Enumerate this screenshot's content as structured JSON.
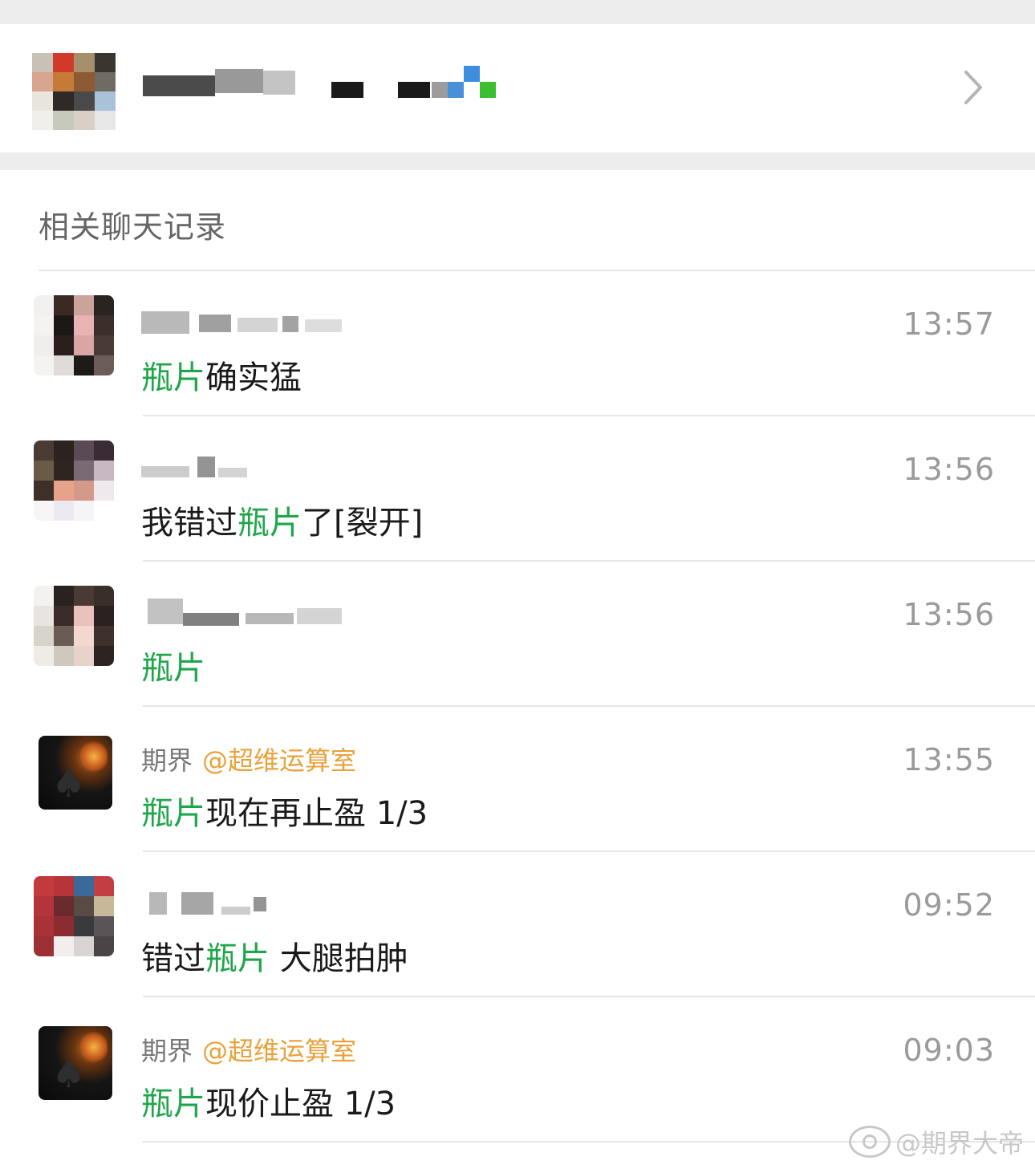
{
  "section_title": "相关聊天记录",
  "results": [
    {
      "sender": "",
      "mention": "",
      "highlight": "瓶片",
      "message_rest": "确实猛",
      "message_prefix": "",
      "time": "13:57"
    },
    {
      "sender": "",
      "mention": "",
      "message_prefix": "我错过",
      "highlight": "瓶片",
      "message_rest": "了[裂开]",
      "time": "13:56"
    },
    {
      "sender": "",
      "mention": "",
      "message_prefix": "",
      "highlight": "瓶片",
      "message_rest": "",
      "time": "13:56"
    },
    {
      "sender": "期界",
      "mention": "@超维运算室",
      "message_prefix": "",
      "highlight": "瓶片",
      "message_rest": "现在再止盈 1/3",
      "time": "13:55"
    },
    {
      "sender": "",
      "mention": "",
      "message_prefix": "错过",
      "highlight": "瓶片",
      "message_rest": " 大腿拍肿",
      "time": "09:52"
    },
    {
      "sender": "期界",
      "mention": "@超维运算室",
      "message_prefix": "",
      "highlight": "瓶片",
      "message_rest": "现价止盈 1/3",
      "time": "09:03"
    }
  ],
  "watermark": "@期界大帝",
  "colors": {
    "highlight": "#20a64a",
    "mention": "#e8a23b",
    "time": "#9a9a9a",
    "background": "#ededed"
  }
}
